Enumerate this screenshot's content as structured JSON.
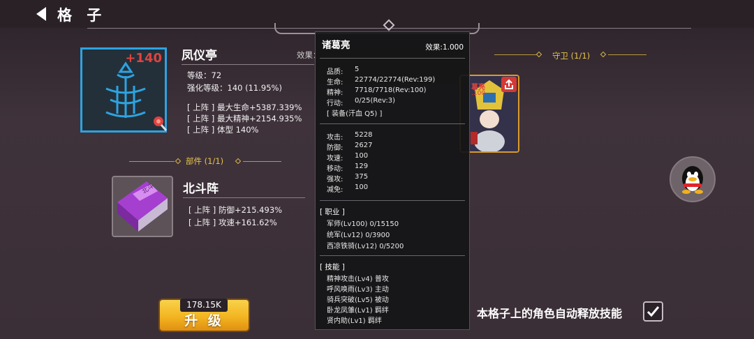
{
  "header": {
    "title": "格 子"
  },
  "relic": {
    "enhance_badge": "+140",
    "name": "凤仪亭",
    "level": "等级：72",
    "enhance": "强化等级：140 (11.95%)",
    "effect_label": "效果：",
    "buffs": [
      "[ 上阵 ] 最大生命+5387.339%",
      "[ 上阵 ] 最大精神+2154.935%",
      "[ 上阵 ] 体型 140%"
    ]
  },
  "parts": {
    "title": "部件 (1/1)",
    "book_name": "北斗阵",
    "buffs": [
      "[ 上阵 ] 防御+215.493%",
      "[ 上阵 ] 攻速+161.62%"
    ]
  },
  "upgrade": {
    "cost": "178.15K",
    "label": "升 级"
  },
  "guard": {
    "title": "守卫 (1/1)",
    "hero_tag": "葛亮",
    "hero_lv": ".100"
  },
  "auto_skill": {
    "label": "本格子上的角色自动释放技能",
    "checked": true
  },
  "tooltip": {
    "name": "诸葛亮",
    "effect_label": "效果:",
    "effect_value": "1.000",
    "info": [
      {
        "k": "品质:",
        "v": "5"
      },
      {
        "k": "生命:",
        "v": "22774/22774(Rev:199)"
      },
      {
        "k": "精神:",
        "v": "7718/7718(Rev:100)"
      },
      {
        "k": "行动:",
        "v": "0/25(Rev:3)"
      }
    ],
    "equip": "[ 装备(汗血 Q5) ]",
    "stats": [
      {
        "k": "攻击:",
        "v": "5228"
      },
      {
        "k": "防御:",
        "v": "2627"
      },
      {
        "k": "攻速:",
        "v": "100"
      },
      {
        "k": "移动:",
        "v": "129"
      },
      {
        "k": "强攻:",
        "v": "375"
      },
      {
        "k": "减免:",
        "v": "100"
      }
    ],
    "jobs_title": "[ 职业 ]",
    "jobs": [
      "军师(Lv100)  0/15150",
      "统军(Lv12)  0/3900",
      "西凉铁骑(Lv12)  0/5200"
    ],
    "skills_title": "[ 技能 ]",
    "skills": [
      "精神攻击(Lv4) 普攻",
      "呼风唤雨(Lv3) 主动",
      "骑兵突破(Lv5) 被动",
      "卧龙凤雏(Lv1) 羁绊",
      "贤内助(Lv1) 羁绊"
    ]
  },
  "colors": {
    "accent_gold": "#e8c64a",
    "relic_border": "#2ea3e0",
    "danger_red": "#e0433f",
    "button_yellow": "#f3b521"
  }
}
